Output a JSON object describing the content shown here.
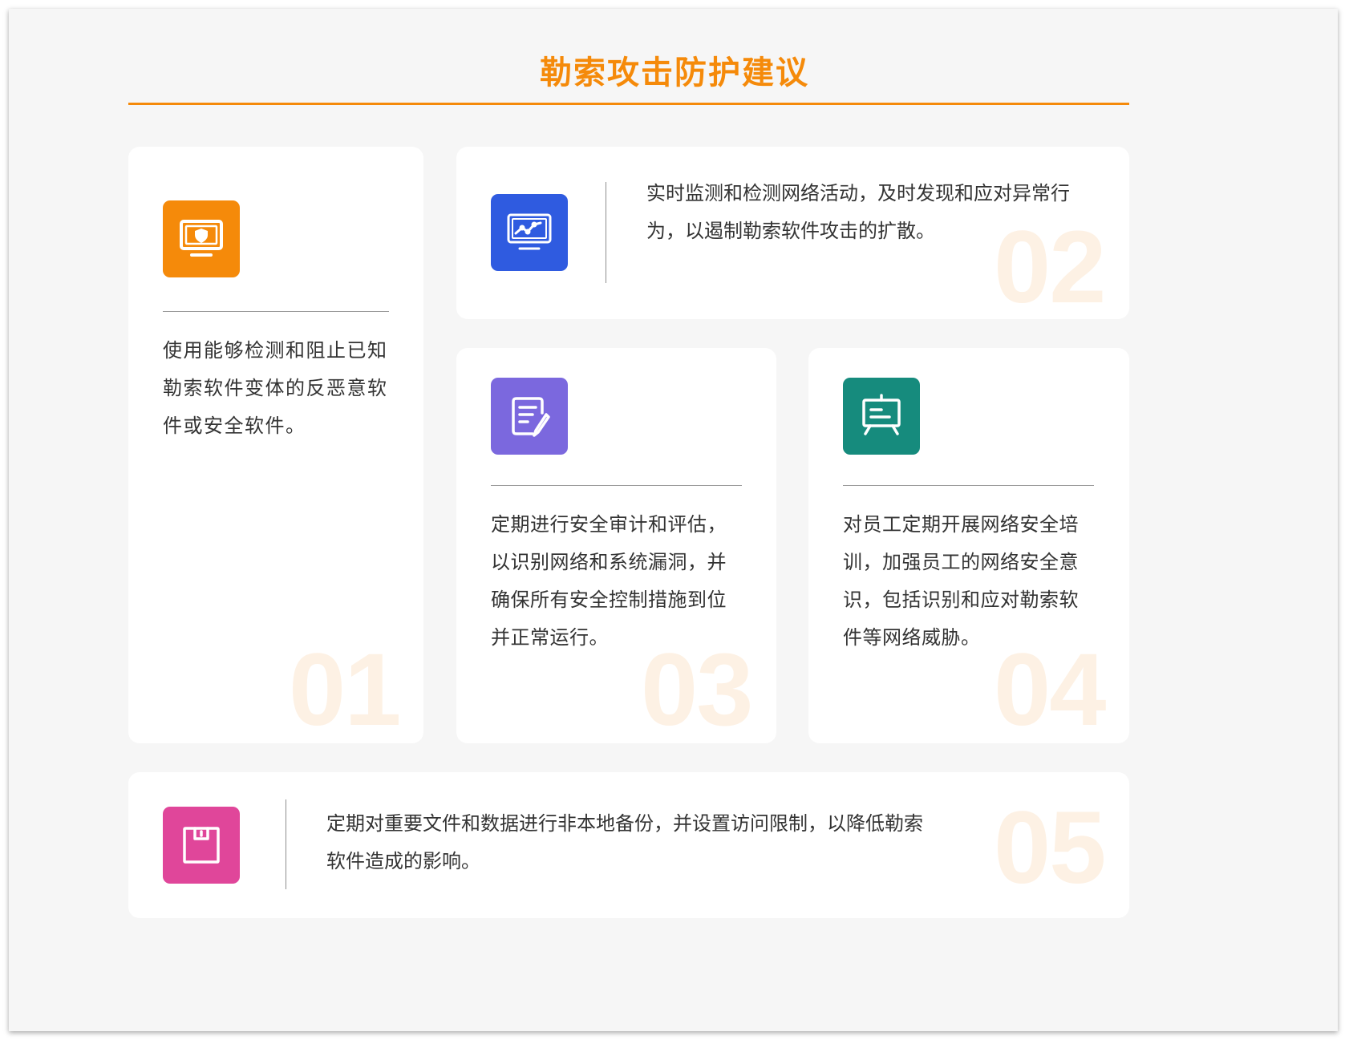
{
  "title": "勒索攻击防护建议",
  "colors": {
    "accent": "#f58a0a",
    "card1": "#f58a0a",
    "card2": "#2f5be0",
    "card3": "#7b68de",
    "card4": "#168b7d",
    "card5": "#e0469a"
  },
  "cards": [
    {
      "number": "01",
      "icon": "monitor-shield-icon",
      "text": "使用能够检测和阻止已知勒索软件变体的反恶意软件或安全软件。"
    },
    {
      "number": "02",
      "icon": "monitor-chart-icon",
      "text": "实时监测和检测网络活动，及时发现和应对异常行为，以遏制勒索软件攻击的扩散。"
    },
    {
      "number": "03",
      "icon": "document-edit-icon",
      "text": "定期进行安全审计和评估，以识别网络和系统漏洞，并确保所有安全控制措施到位并正常运行。"
    },
    {
      "number": "04",
      "icon": "presentation-board-icon",
      "text": "对员工定期开展网络安全培训，加强员工的网络安全意识，包括识别和应对勒索软件等网络威胁。"
    },
    {
      "number": "05",
      "icon": "backup-box-icon",
      "text": "定期对重要文件和数据进行非本地备份，并设置访问限制，以降低勒索软件造成的影响。"
    }
  ]
}
